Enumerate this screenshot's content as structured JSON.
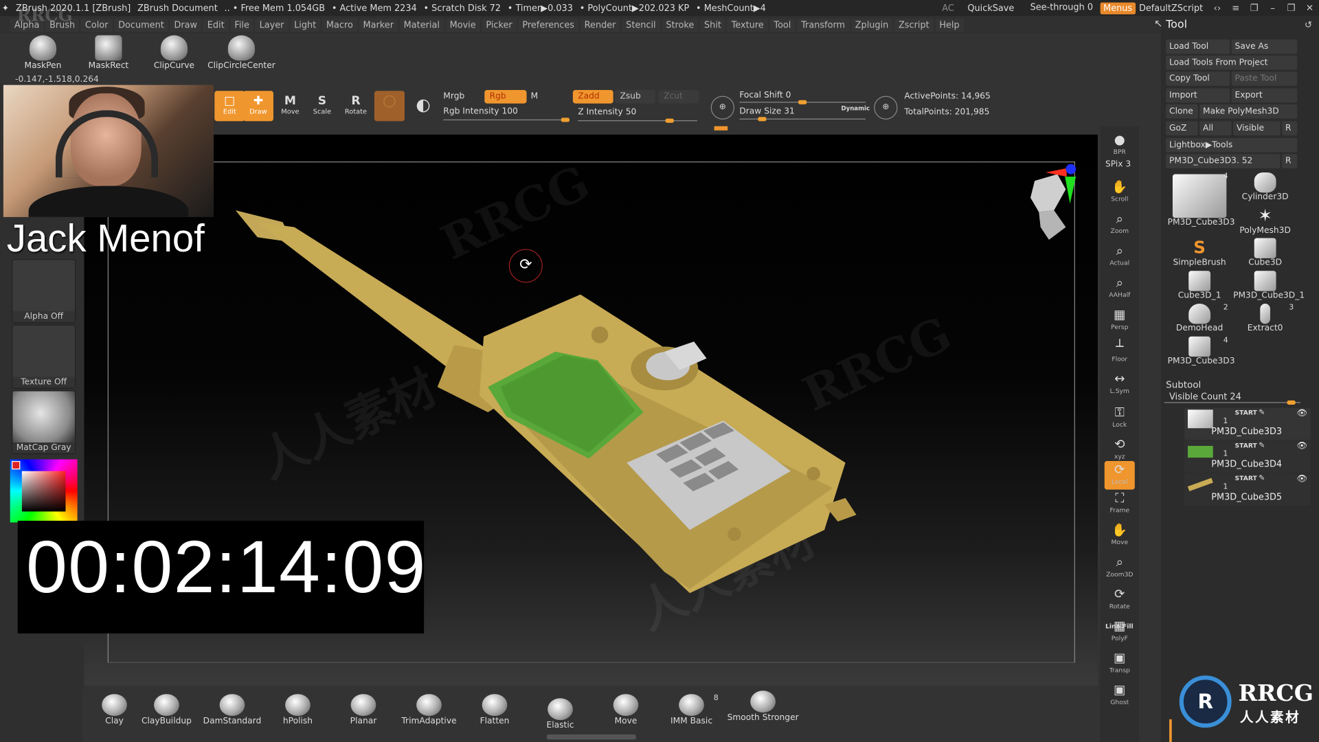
{
  "titlebar": {
    "app_title": "ZBrush 2020.1.1 [ZBrush]",
    "document": "ZBrush Document",
    "free_mem": ".. • Free Mem 1.054GB",
    "active_mem": "• Active Mem 2234",
    "scratch_disk": "• Scratch Disk 72",
    "timer": "• Timer▶0.033",
    "polycount": "• PolyCount▶202.023 KP",
    "meshcount": "• MeshCount▶4",
    "ac_label": "AC",
    "quicksave_label": "QuickSave",
    "see_through_label": "See-through",
    "see_through_value": "0",
    "menus_label": "Menus",
    "default_zscript_label": "DefaultZScript"
  },
  "menubar": {
    "items": [
      "Alpha",
      "Brush",
      "Color",
      "Document",
      "Draw",
      "Edit",
      "File",
      "Layer",
      "Light",
      "Macro",
      "Marker",
      "Material",
      "Movie",
      "Picker",
      "Preferences",
      "Render",
      "Stencil",
      "Stroke",
      "Shit",
      "Texture",
      "Tool",
      "Transform",
      "Zplugin",
      "Zscript",
      "Help"
    ]
  },
  "shelf": {
    "items": [
      {
        "label": "MaskPen"
      },
      {
        "label": "MaskRect"
      },
      {
        "label": "ClipCurve"
      },
      {
        "label": "ClipCircleCenter"
      }
    ],
    "coords": "-0.147,-1.518,0.264"
  },
  "controls": {
    "edit_label": "Edit",
    "draw_label": "Draw",
    "move_label": "Move",
    "scale_label": "Scale",
    "rotate_label": "Rotate",
    "mrgb_label": "Mrgb",
    "rgb_label": "Rgb",
    "m_label": "M",
    "rgb_intensity_label": "Rgb Intensity 100",
    "zadd_label": "Zadd",
    "zsub_label": "Zsub",
    "zcut_label": "Zcut",
    "z_intensity_label": "Z Intensity 50",
    "focal_shift_label": "Focal Shift 0",
    "draw_size_label": "Draw Size 31",
    "dynamic_label": "Dynamic",
    "active_points": "ActivePoints: 14,965",
    "total_points": "TotalPoints: 201,985",
    "rgb_intensity_fraction": 1.0,
    "z_intensity_fraction": 0.5
  },
  "overlay": {
    "streamer_name": "Jack Menof",
    "elapsed_timer": "00:02:14:09"
  },
  "leftcol": {
    "alpha_label": "Alpha Off",
    "texture_label": "Texture Off",
    "material_label": "MatCap Gray"
  },
  "righttools": {
    "spix_label": "SPix 3",
    "buttons": [
      {
        "label": "BPR",
        "glyph": "●"
      },
      {
        "label": "Scroll",
        "glyph": "✋"
      },
      {
        "label": "Zoom",
        "glyph": "⌕"
      },
      {
        "label": "Actual",
        "glyph": "⌕"
      },
      {
        "label": "AAHalf",
        "glyph": "⌕"
      },
      {
        "label": "Persp",
        "glyph": "▦"
      },
      {
        "label": "Floor",
        "glyph": "┴"
      },
      {
        "label": "L.Sym",
        "glyph": "↔"
      },
      {
        "label": "Lock",
        "glyph": "⚿"
      },
      {
        "label": "xyz",
        "glyph": "⟲"
      },
      {
        "label": "Local",
        "glyph": "⟳"
      },
      {
        "label": "Frame",
        "glyph": "⛶"
      },
      {
        "label": "Move",
        "glyph": "✋"
      },
      {
        "label": "Zoom3D",
        "glyph": "⌕"
      },
      {
        "label": "Rotate",
        "glyph": "⟳"
      },
      {
        "label": "PolyF",
        "glyph": "▦"
      },
      {
        "label": "Transp",
        "glyph": "▣"
      },
      {
        "label": "Ghost",
        "glyph": "▣"
      }
    ],
    "line_fill_label": "Line Fill"
  },
  "toolpanel": {
    "title": "Tool",
    "buttons": [
      {
        "label": "Load Tool"
      },
      {
        "label": "Save As"
      },
      {
        "label": "Load Tools From Project"
      },
      {
        "label": "Copy Tool"
      },
      {
        "label": "Paste Tool"
      },
      {
        "label": "Import"
      },
      {
        "label": "Export"
      },
      {
        "label": "Clone"
      },
      {
        "label": "Make PolyMesh3D"
      },
      {
        "label": "GoZ"
      },
      {
        "label": "All"
      },
      {
        "label": "Visible"
      },
      {
        "label": "R"
      },
      {
        "label": "Lightbox▶Tools"
      }
    ],
    "current_tool": "PM3D_Cube3D3. 52",
    "r_label": "R",
    "tools": [
      {
        "label": "PM3D_Cube3D3",
        "count": "4"
      },
      {
        "label": "Cylinder3D",
        "count": ""
      },
      {
        "label": "PolyMesh3D",
        "count": ""
      },
      {
        "label": "SimpleBrush",
        "count": ""
      },
      {
        "label": "Cube3D",
        "count": ""
      },
      {
        "label": "Cube3D_1",
        "count": ""
      },
      {
        "label": "PM3D_Cube3D_1",
        "count": ""
      },
      {
        "label": "DemoHead",
        "count": "2"
      },
      {
        "label": "Extract0",
        "count": "3"
      },
      {
        "label": "PM3D_Cube3D3",
        "count": "4"
      }
    ],
    "subtool_header": "Subtool",
    "visible_count": "Visible Count 24",
    "subtools": [
      {
        "name": "PM3D_Cube3D3",
        "start": "START",
        "num": "1"
      },
      {
        "name": "PM3D_Cube3D4",
        "start": "START",
        "num": "1"
      },
      {
        "name": "PM3D_Cube3D5",
        "start": "START",
        "num": "1"
      }
    ]
  },
  "brushbar": {
    "brushes": [
      {
        "label": "Clay"
      },
      {
        "label": "ClayBuildup"
      },
      {
        "label": "DamStandard"
      },
      {
        "label": "hPolish"
      },
      {
        "label": "Planar"
      },
      {
        "label": "TrimAdaptive"
      },
      {
        "label": "Flatten"
      },
      {
        "label": "Elastic"
      },
      {
        "label": "Move"
      },
      {
        "label": "IMM Basic",
        "count": "8"
      },
      {
        "label": "Smooth Stronger"
      }
    ]
  },
  "watermark": {
    "brand": "RRCG",
    "cn": "人人素材",
    "logo_text": "RRCG",
    "logo_sub": "人人素材"
  },
  "colors": {
    "accent_orange": "#f0962e",
    "model_gold": "#c8ab55",
    "model_green": "#5aa83a",
    "model_gray": "#c8c8c8",
    "axis_red": "#ff3020",
    "axis_green": "#20e020",
    "axis_blue": "#2030ff"
  }
}
